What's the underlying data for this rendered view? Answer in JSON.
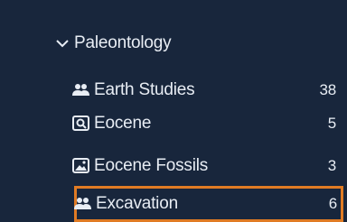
{
  "tree": {
    "parent": {
      "label": "Paleontology",
      "icon": "chevron-down-icon"
    },
    "items": [
      {
        "label": "Earth Studies",
        "count": "38",
        "icon": "people-icon"
      },
      {
        "label": "Eocene",
        "count": "5",
        "icon": "search-document-icon"
      },
      {
        "label": "Eocene Fossils",
        "count": "3",
        "icon": "image-icon"
      },
      {
        "label": "Excavation",
        "count": "6",
        "icon": "people-icon",
        "selected": true
      }
    ]
  },
  "colors": {
    "background": "#18263c",
    "text": "#e8edf4",
    "selection_border": "#e07b24"
  }
}
